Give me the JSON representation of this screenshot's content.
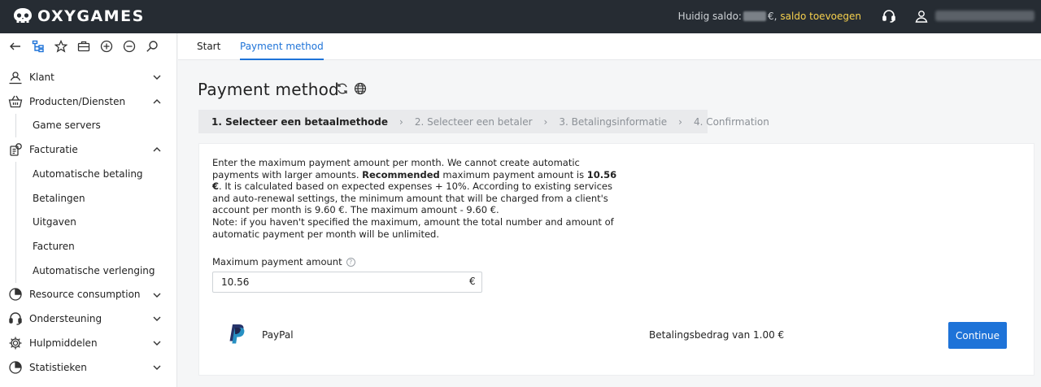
{
  "brand": {
    "name": "OXYGAMES"
  },
  "header": {
    "balance_label": "Huidig saldo:",
    "balance_suffix": "€,",
    "add_balance": "saldo toevoegen"
  },
  "sidebar": {
    "toolbar_icons": [
      "back-icon",
      "tree-icon",
      "star-icon",
      "briefcase-icon",
      "zoom-in-icon",
      "zoom-out-icon",
      "search-icon"
    ],
    "items": [
      {
        "label": "Klant",
        "icon": "user-location-icon",
        "expanded": false
      },
      {
        "label": "Producten/Diensten",
        "icon": "basket-icon",
        "expanded": true,
        "children": [
          "Game servers"
        ]
      },
      {
        "label": "Facturatie",
        "icon": "coins-icon",
        "expanded": true,
        "children": [
          "Automatische betaling",
          "Betalingen",
          "Uitgaven",
          "Facturen",
          "Automatische verlenging"
        ]
      },
      {
        "label": "Resource consumption",
        "icon": "pie-chart-icon",
        "expanded": false
      },
      {
        "label": "Ondersteuning",
        "icon": "headset-icon",
        "expanded": false
      },
      {
        "label": "Hulpmiddelen",
        "icon": "gear-icon",
        "expanded": false
      },
      {
        "label": "Statistieken",
        "icon": "pie-chart-icon",
        "expanded": false
      }
    ]
  },
  "tabs": [
    {
      "label": "Start",
      "active": false
    },
    {
      "label": "Payment method",
      "active": true
    }
  ],
  "page": {
    "title": "Payment method",
    "steps": [
      "1. Selecteer een betaalmethode",
      "2. Selecteer een betaler",
      "3. Betalingsinformatie",
      "4. Confirmation"
    ],
    "active_step": 0,
    "info": {
      "p1": "Enter the maximum payment amount per month. We cannot create automatic payments with larger amounts. ",
      "p1_bold": "Recommended",
      "p2": " maximum payment amount is ",
      "p2_bold": "10.56 €",
      "p3": ". It is calculated based on expected expenses + 10%. According to existing services and auto-renewal settings, the minimum amount that will be charged from a client's account per month is 9.60 €. The maximum amount - 9.60 €.",
      "p4": "Note: if you haven't specified the maximum, amount the total number and amount of automatic payment per month will be unlimited."
    },
    "field": {
      "label": "Maximum payment amount",
      "help": "?",
      "value": "10.56",
      "currency": "€"
    },
    "method": {
      "name": "PayPal",
      "amount": "Betalingsbedrag van 1.00 €",
      "button": "Continue"
    }
  },
  "colors": {
    "header_bg": "#262c33",
    "accent": "#1e73d8",
    "add_balance": "#f6d04d"
  }
}
